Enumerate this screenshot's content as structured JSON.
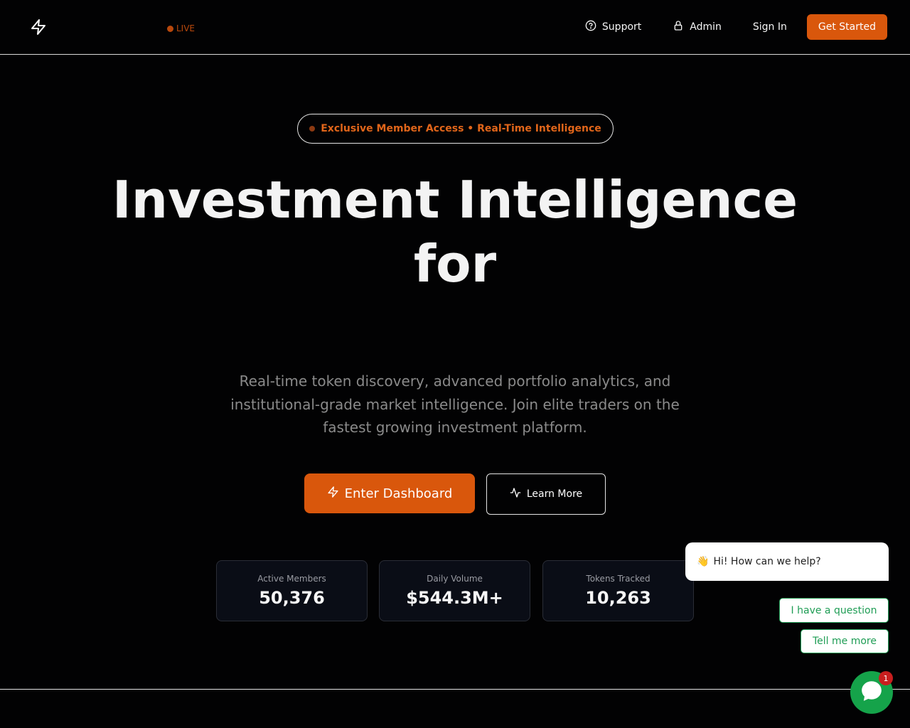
{
  "header": {
    "live_label": "LIVE",
    "nav": {
      "support_label": "Support",
      "admin_label": "Admin",
      "signin_label": "Sign In",
      "get_started_label": "Get Started"
    }
  },
  "hero": {
    "badge_text": "Exclusive Member Access • Real-Time Intelligence",
    "title_line1": "Investment Intelligence",
    "title_line2": "for",
    "subtitle": "Real-time token discovery, advanced portfolio analytics, and institutional-grade market intelligence. Join elite traders on the fastest growing investment platform.",
    "primary_cta": "Enter Dashboard",
    "secondary_cta": "Learn More"
  },
  "stats": [
    {
      "label": "Active Members",
      "value": "50,376"
    },
    {
      "label": "Daily Volume",
      "value": "$544.3M+"
    },
    {
      "label": "Tokens Tracked",
      "value": "10,263"
    }
  ],
  "chat": {
    "greeting": "Hi! How can we help?",
    "greeting_emoji": "👋",
    "quick_replies": [
      "I have a question",
      "Tell me more"
    ],
    "unread_count": "1"
  },
  "colors": {
    "background": "#020203",
    "accent": "#d9570c",
    "accent_text": "#e0651a",
    "chat_green": "#15a34a",
    "badge_red": "#c81e1e"
  },
  "icons": {
    "logo": "lightning-bolt-icon",
    "support": "help-circle-icon",
    "admin": "lock-icon",
    "primary_cta": "lightning-bolt-icon",
    "secondary_cta": "activity-pulse-icon",
    "chat": "chat-bubble-icon"
  }
}
